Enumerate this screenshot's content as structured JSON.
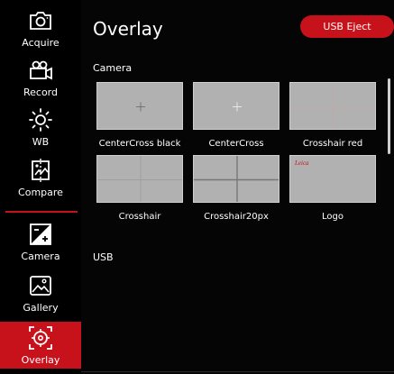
{
  "sidebar": {
    "items": [
      {
        "label": "Acquire",
        "icon": "camera-icon"
      },
      {
        "label": "Record",
        "icon": "video-camera-icon"
      },
      {
        "label": "WB",
        "icon": "sun-icon"
      },
      {
        "label": "Compare",
        "icon": "compare-icon"
      },
      {
        "label": "Camera",
        "icon": "exposure-icon"
      },
      {
        "label": "Gallery",
        "icon": "image-icon"
      },
      {
        "label": "Overlay",
        "icon": "target-icon"
      }
    ],
    "active_item": "Overlay"
  },
  "header": {
    "title": "Overlay",
    "eject_label": "USB Eject"
  },
  "sections": {
    "camera": "Camera",
    "usb": "USB"
  },
  "overlays": [
    {
      "label": "CenterCross black",
      "icon": "center-cross-black-icon"
    },
    {
      "label": "CenterCross",
      "icon": "center-cross-icon"
    },
    {
      "label": "Crosshair red",
      "icon": "crosshair-red-icon"
    },
    {
      "label": "Crosshair",
      "icon": "crosshair-icon"
    },
    {
      "label": "Crosshair20px",
      "icon": "crosshair-20px-icon"
    },
    {
      "label": "Logo",
      "icon": "logo-icon"
    }
  ],
  "logo_text": "Leica",
  "colors": {
    "accent": "#c8121b",
    "background": "#050505",
    "thumbnail": "#b1b1b1"
  }
}
